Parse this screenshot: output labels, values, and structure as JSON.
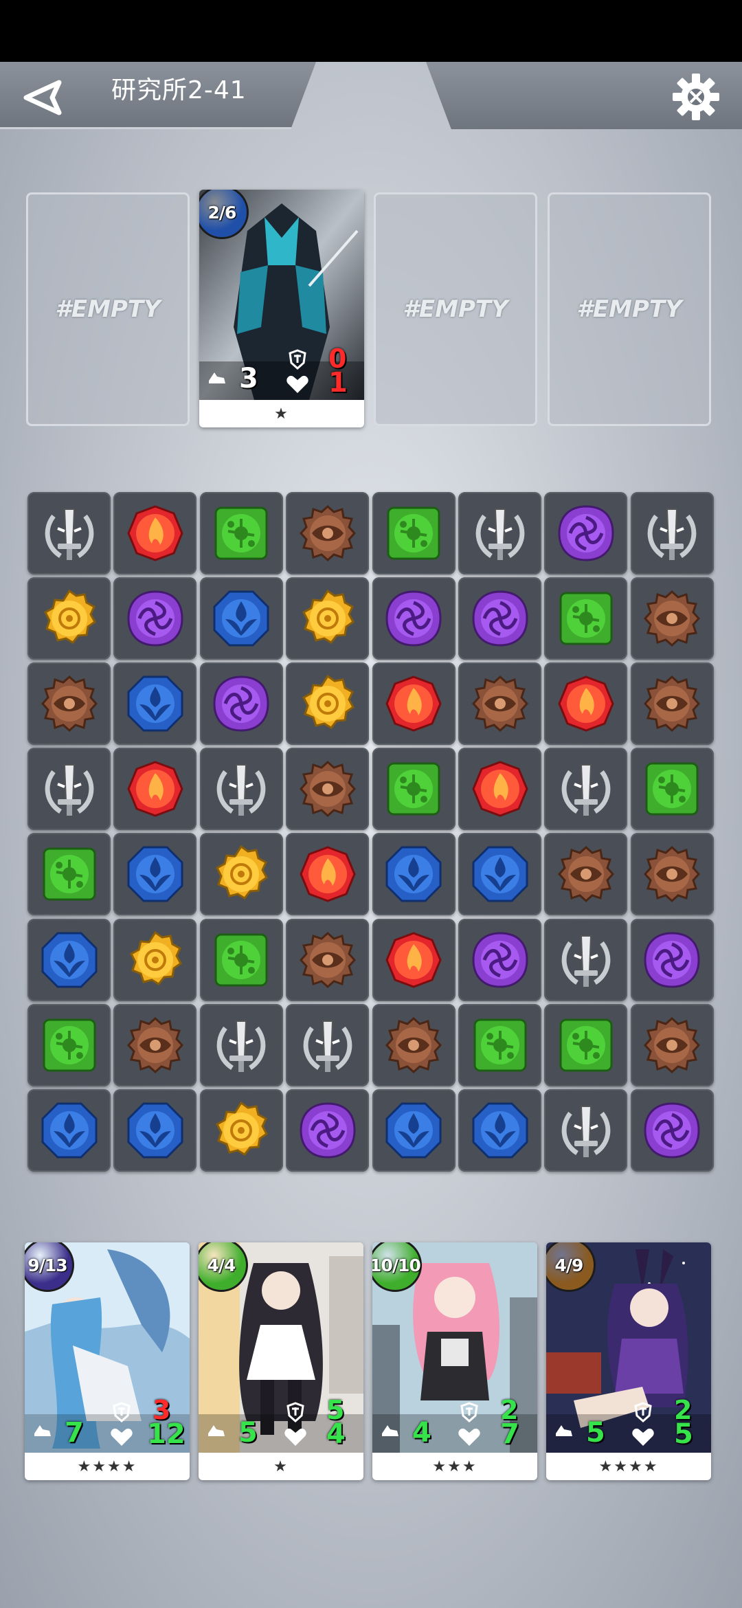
{
  "header": {
    "stage_title": "研究所2-41"
  },
  "top_team": [
    {
      "empty": true,
      "label": "#EMPTY"
    },
    {
      "empty": false,
      "hp_badge": "2/6",
      "badge_color": "#1f4fa8",
      "speed": "3",
      "defense": "0",
      "health": "1",
      "stars": "★",
      "def_color": "#ff2a2a",
      "hp_color": "#ff2a2a"
    },
    {
      "empty": true,
      "label": "#EMPTY"
    },
    {
      "empty": true,
      "label": "#EMPTY"
    }
  ],
  "board": {
    "rows": [
      [
        "sword",
        "fire",
        "nature",
        "eye",
        "nature",
        "sword",
        "void",
        "sword"
      ],
      [
        "sun",
        "void",
        "water",
        "sun",
        "void",
        "void",
        "nature",
        "eye"
      ],
      [
        "eye",
        "water",
        "void",
        "sun",
        "fire",
        "eye",
        "fire",
        "eye"
      ],
      [
        "sword",
        "fire",
        "sword",
        "eye",
        "nature",
        "fire",
        "sword",
        "nature"
      ],
      [
        "nature",
        "water",
        "sun",
        "fire",
        "water",
        "water",
        "eye",
        "eye"
      ],
      [
        "water",
        "sun",
        "nature",
        "eye",
        "fire",
        "void",
        "sword",
        "void"
      ],
      [
        "nature",
        "eye",
        "sword",
        "sword",
        "eye",
        "nature",
        "nature",
        "eye"
      ],
      [
        "water",
        "water",
        "sun",
        "void",
        "water",
        "water",
        "sword",
        "void"
      ]
    ],
    "gem_icons": {
      "sword": "sword-emblem-icon",
      "fire": "fire-gem-icon",
      "nature": "nature-gem-icon",
      "eye": "eye-gem-icon",
      "sun": "sun-gem-icon",
      "void": "void-gem-icon",
      "water": "water-gem-icon"
    }
  },
  "bottom_team": [
    {
      "hp_badge": "9/13",
      "badge_color": "#3b2e8a",
      "speed": "7",
      "defense": "3",
      "health": "12",
      "stars": "★★★★",
      "def_color": "#ff2a2a",
      "hp_color": "#36e34a"
    },
    {
      "hp_badge": "4/4",
      "badge_color": "#3fae2c",
      "speed": "5",
      "defense": "5",
      "health": "4",
      "stars": "★",
      "def_color": "#36e34a",
      "hp_color": "#36e34a"
    },
    {
      "hp_badge": "10/10",
      "badge_color": "#3fae2c",
      "speed": "4",
      "defense": "2",
      "health": "7",
      "stars": "★★★",
      "def_color": "#36e34a",
      "hp_color": "#36e34a"
    },
    {
      "hp_badge": "4/9",
      "badge_color": "#8a5a1f",
      "speed": "5",
      "defense": "2",
      "health": "5",
      "stars": "★★★★",
      "def_color": "#36e34a",
      "hp_color": "#36e34a"
    }
  ],
  "colors": {
    "cell_bg": "#4a4f57",
    "fire": "#e2262b",
    "nature": "#3fae2c",
    "eye": "#8a5238",
    "sun": "#f0b021",
    "void": "#8b3fd1",
    "water": "#2660c7",
    "sword": "#c9ccd1"
  }
}
